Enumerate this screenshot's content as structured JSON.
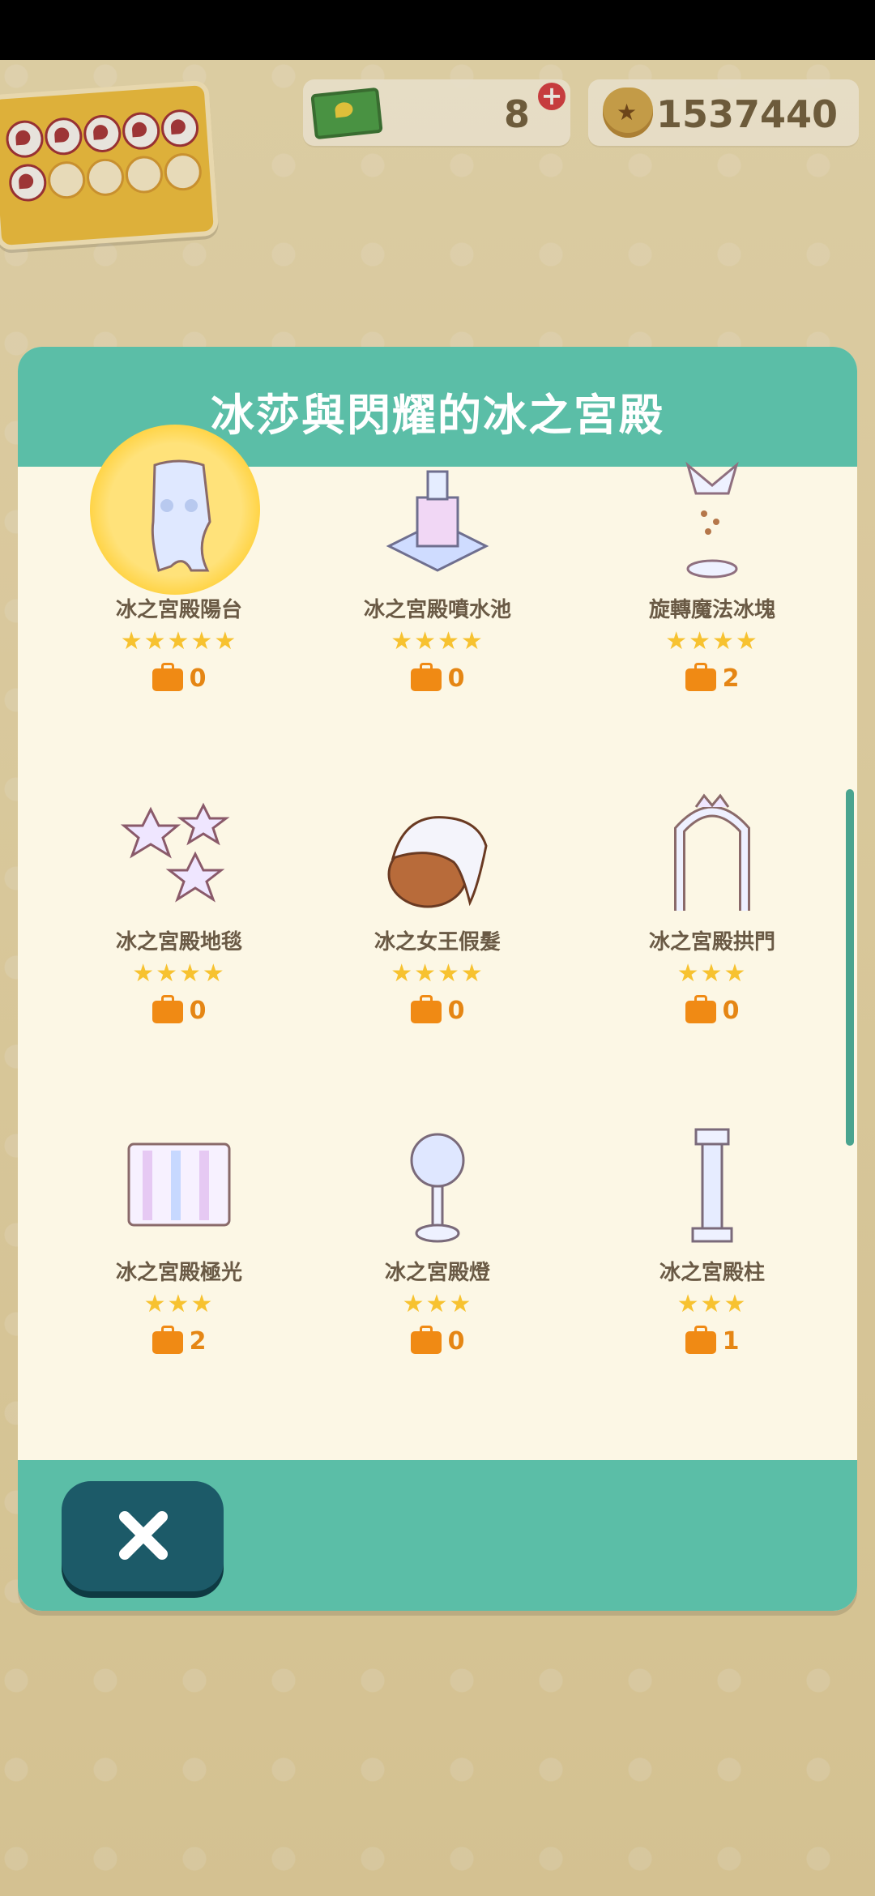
{
  "hud": {
    "tickets": "8",
    "bells": "1537440",
    "stamp_card": {
      "filled": 6,
      "total": 10
    }
  },
  "dialog": {
    "title": "冰莎與閃耀的冰之宮殿",
    "items": [
      {
        "name": "冰之宮殿陽台",
        "stars": "★★★★★",
        "count": "0",
        "icon": "ice-balcony-icon",
        "highlight": true
      },
      {
        "name": "冰之宮殿噴水池",
        "stars": "★★★★",
        "count": "0",
        "icon": "ice-fountain-icon"
      },
      {
        "name": "旋轉魔法冰塊",
        "stars": "★★★★",
        "count": "2",
        "icon": "magic-ice-icon"
      },
      {
        "name": "冰之宮殿地毯",
        "stars": "★★★★",
        "count": "0",
        "icon": "snowflake-rug-icon"
      },
      {
        "name": "冰之女王假髮",
        "stars": "★★★★",
        "count": "0",
        "icon": "ice-queen-wig-icon"
      },
      {
        "name": "冰之宮殿拱門",
        "stars": "★★★",
        "count": "0",
        "icon": "ice-arch-icon"
      },
      {
        "name": "冰之宮殿極光",
        "stars": "★★★",
        "count": "2",
        "icon": "aurora-icon"
      },
      {
        "name": "冰之宮殿燈",
        "stars": "★★★",
        "count": "0",
        "icon": "ice-lamp-icon"
      },
      {
        "name": "冰之宮殿柱",
        "stars": "★★★",
        "count": "1",
        "icon": "ice-pillar-icon"
      }
    ],
    "close_icon": "close-icon"
  }
}
